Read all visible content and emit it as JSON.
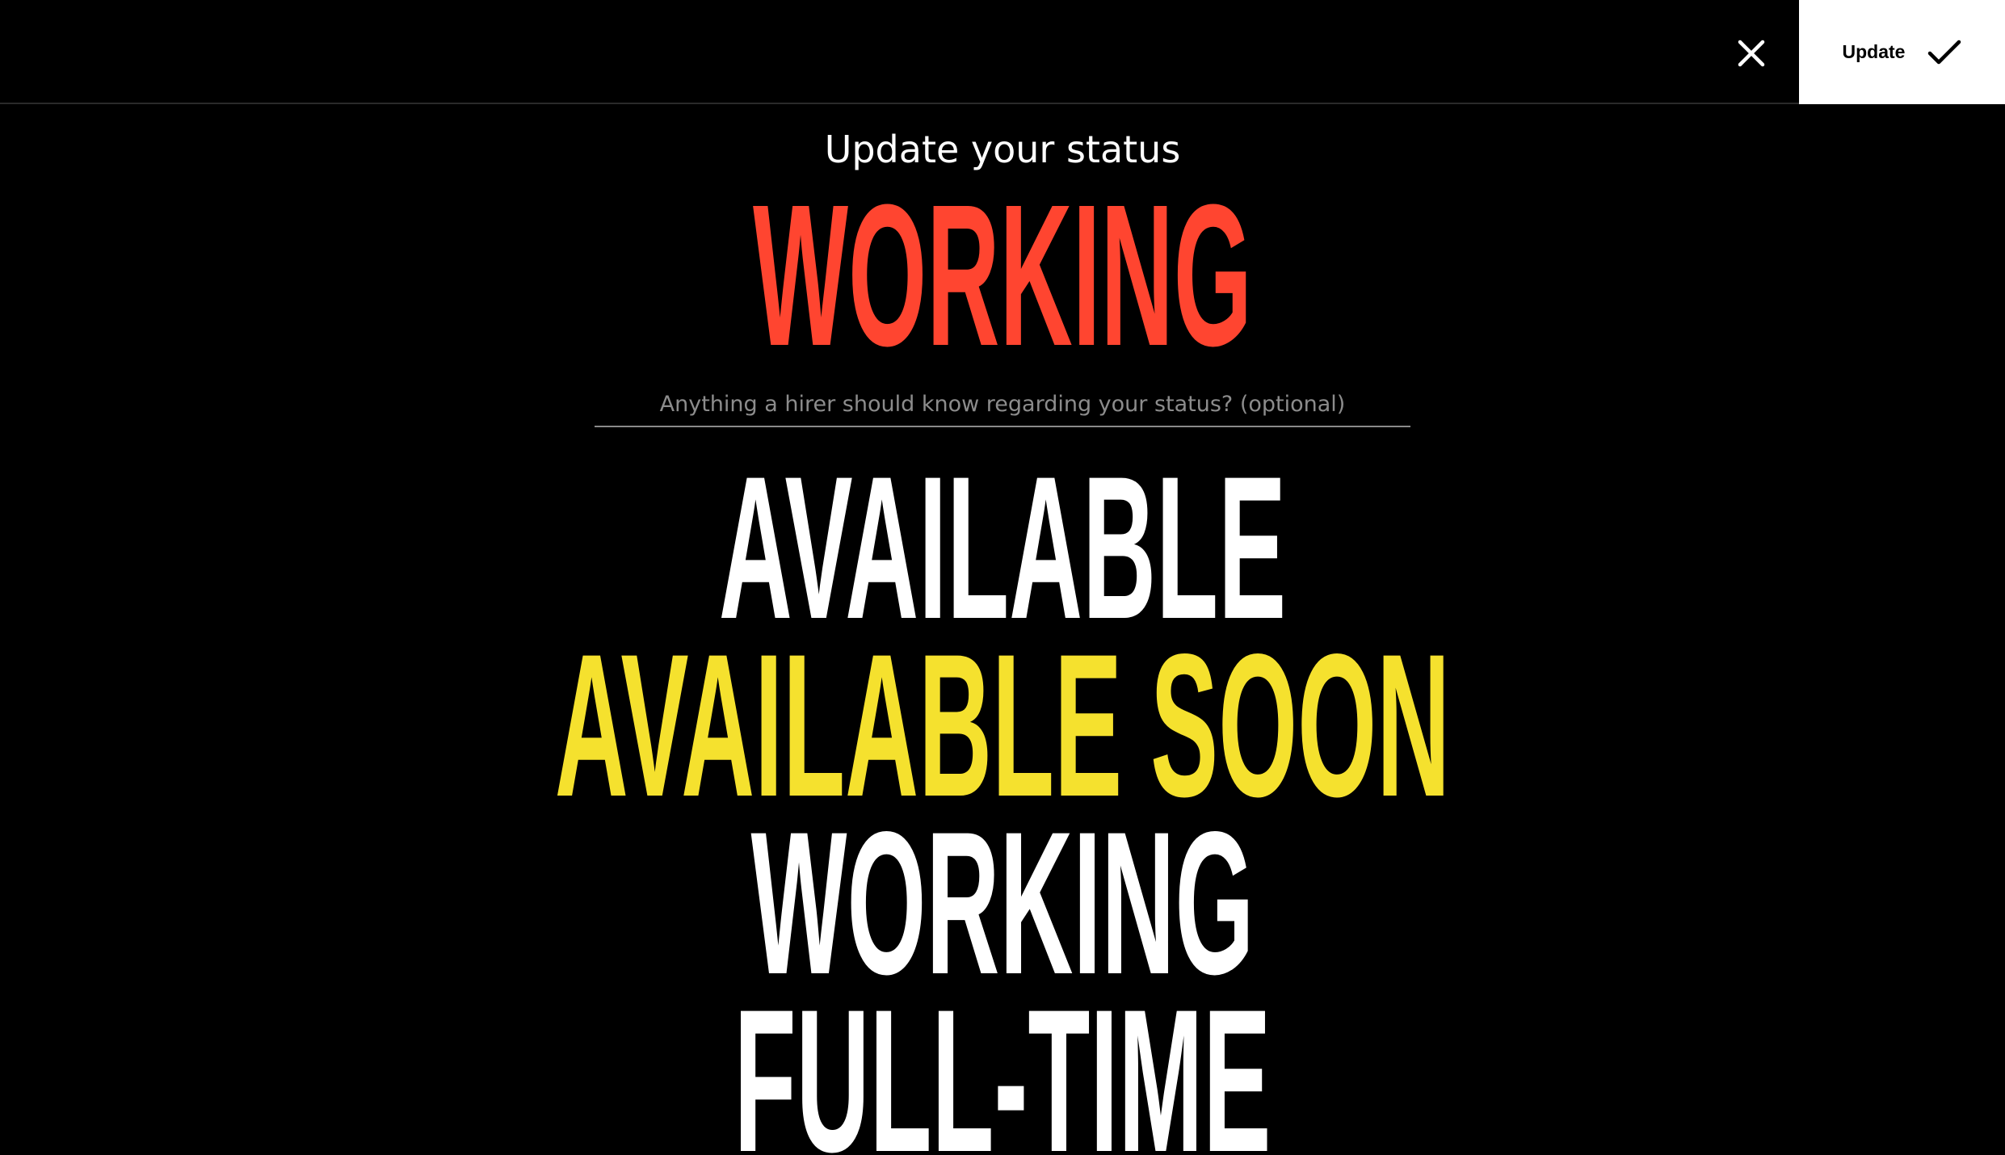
{
  "toolbar": {
    "close_icon": "close-icon",
    "update_label": "Update",
    "check_icon": "checkmark-icon"
  },
  "status": {
    "heading": "Update your status",
    "current": "WORKING",
    "current_color": "#ff4530"
  },
  "note": {
    "placeholder": "Anything a hirer should know regarding your status? (optional)",
    "value": ""
  },
  "options": [
    {
      "label": "AVAILABLE",
      "color": "#ffffff"
    },
    {
      "label": "AVAILABLE SOON",
      "color": "#f5e12e"
    },
    {
      "label": "WORKING",
      "color": "#ffffff"
    },
    {
      "label": "FULL-TIME",
      "color": "#ffffff"
    }
  ]
}
